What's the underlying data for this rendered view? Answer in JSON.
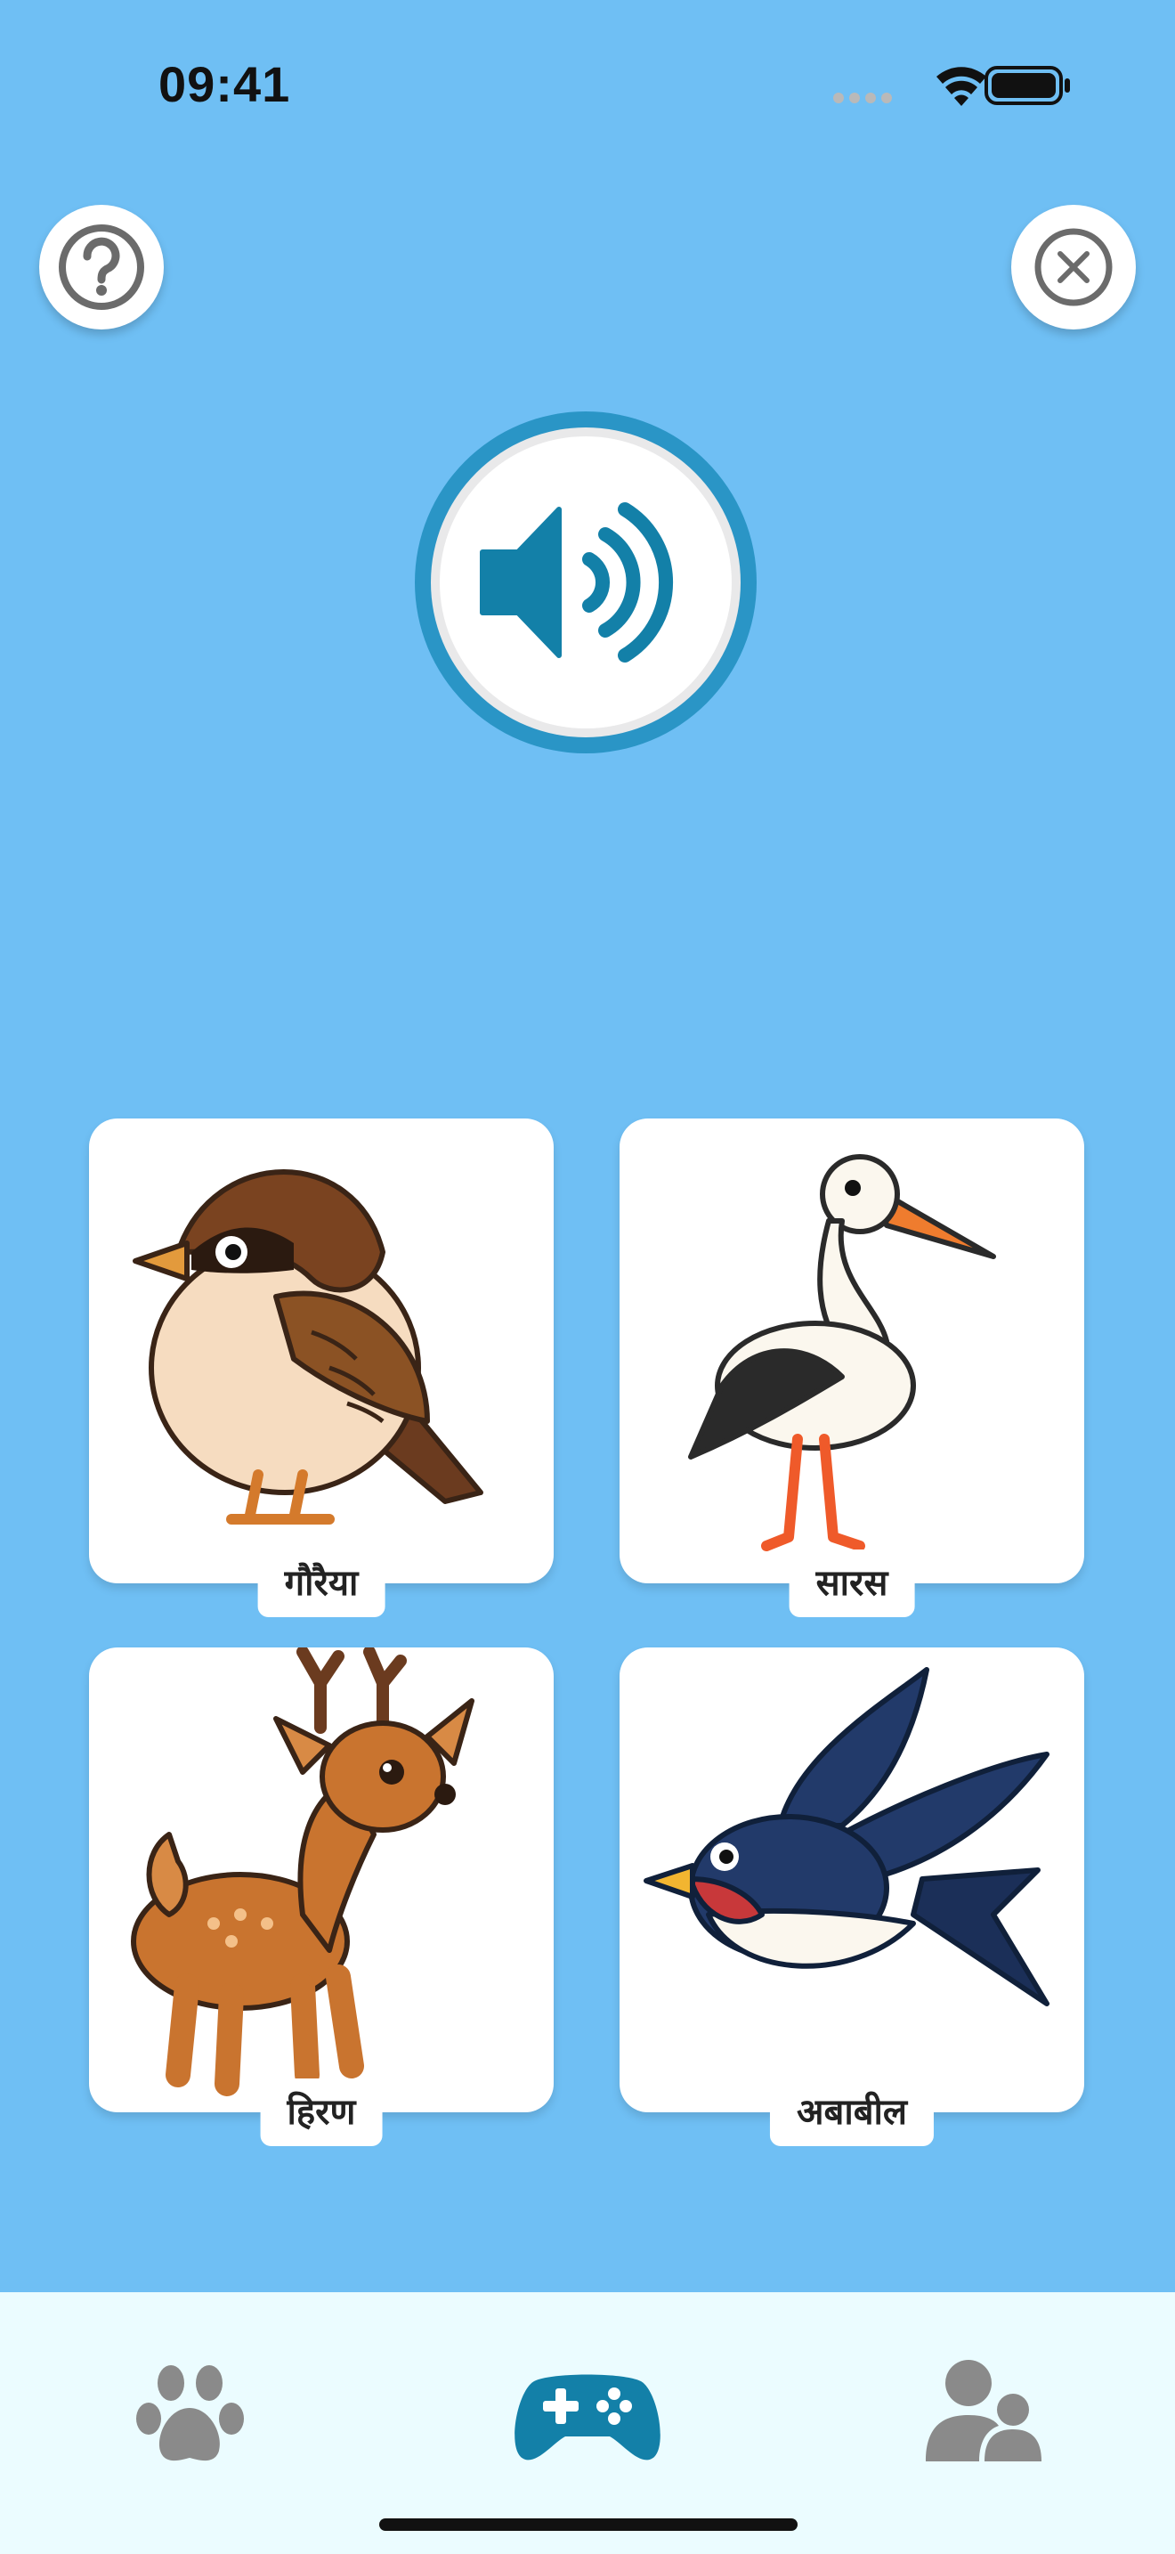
{
  "status_bar": {
    "time": "09:41",
    "icons": [
      "signal-dots-icon",
      "wifi-icon",
      "battery-icon"
    ]
  },
  "header": {
    "help_icon": "question-circle-icon",
    "close_icon": "close-circle-icon"
  },
  "audio": {
    "icon": "speaker-volume-icon",
    "ring_color": "#2a95c6",
    "icon_color": "#1380a8"
  },
  "options": [
    {
      "label": "गौरैया",
      "image": "sparrow"
    },
    {
      "label": "सारस",
      "image": "stork"
    },
    {
      "label": "हिरण",
      "image": "deer"
    },
    {
      "label": "अबाबील",
      "image": "swallow"
    }
  ],
  "tab_bar": {
    "tabs": [
      {
        "icon": "paw-icon",
        "active": false
      },
      {
        "icon": "gamepad-icon",
        "active": true
      },
      {
        "icon": "users-icon",
        "active": false
      }
    ],
    "active_color": "#1380a8",
    "inactive_color": "#8a8a8a"
  },
  "colors": {
    "background": "#6fbff4",
    "tab_bar_background": "#ebfcff"
  }
}
